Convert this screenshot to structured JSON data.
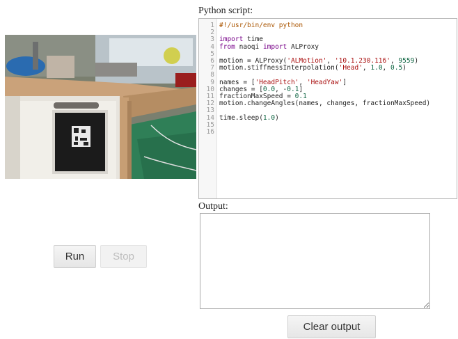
{
  "labels": {
    "script": "Python script:",
    "output": "Output:"
  },
  "buttons": {
    "run": "Run",
    "stop": "Stop",
    "clear_output": "Clear output"
  },
  "output": {
    "value": ""
  },
  "editor": {
    "line_numbers": [
      "1",
      "2",
      "3",
      "4",
      "5",
      "6",
      "7",
      "8",
      "9",
      "10",
      "11",
      "12",
      "13",
      "14",
      "15",
      "16"
    ],
    "lines": [
      "#!/usr/bin/env python",
      "",
      "import time",
      "from naoqi import ALProxy",
      "",
      "motion = ALProxy('ALMotion', '10.1.230.116', 9559)",
      "motion.stiffnessInterpolation('Head', 1.0, 0.5)",
      "",
      "names = ['HeadPitch', 'HeadYaw']",
      "changes = [0.0, -0.1]",
      "fractionMaxSpeed = 0.1",
      "motion.changeAngles(names, changes, fractionMaxSpeed)",
      "",
      "time.sleep(1.0)",
      "",
      ""
    ]
  }
}
